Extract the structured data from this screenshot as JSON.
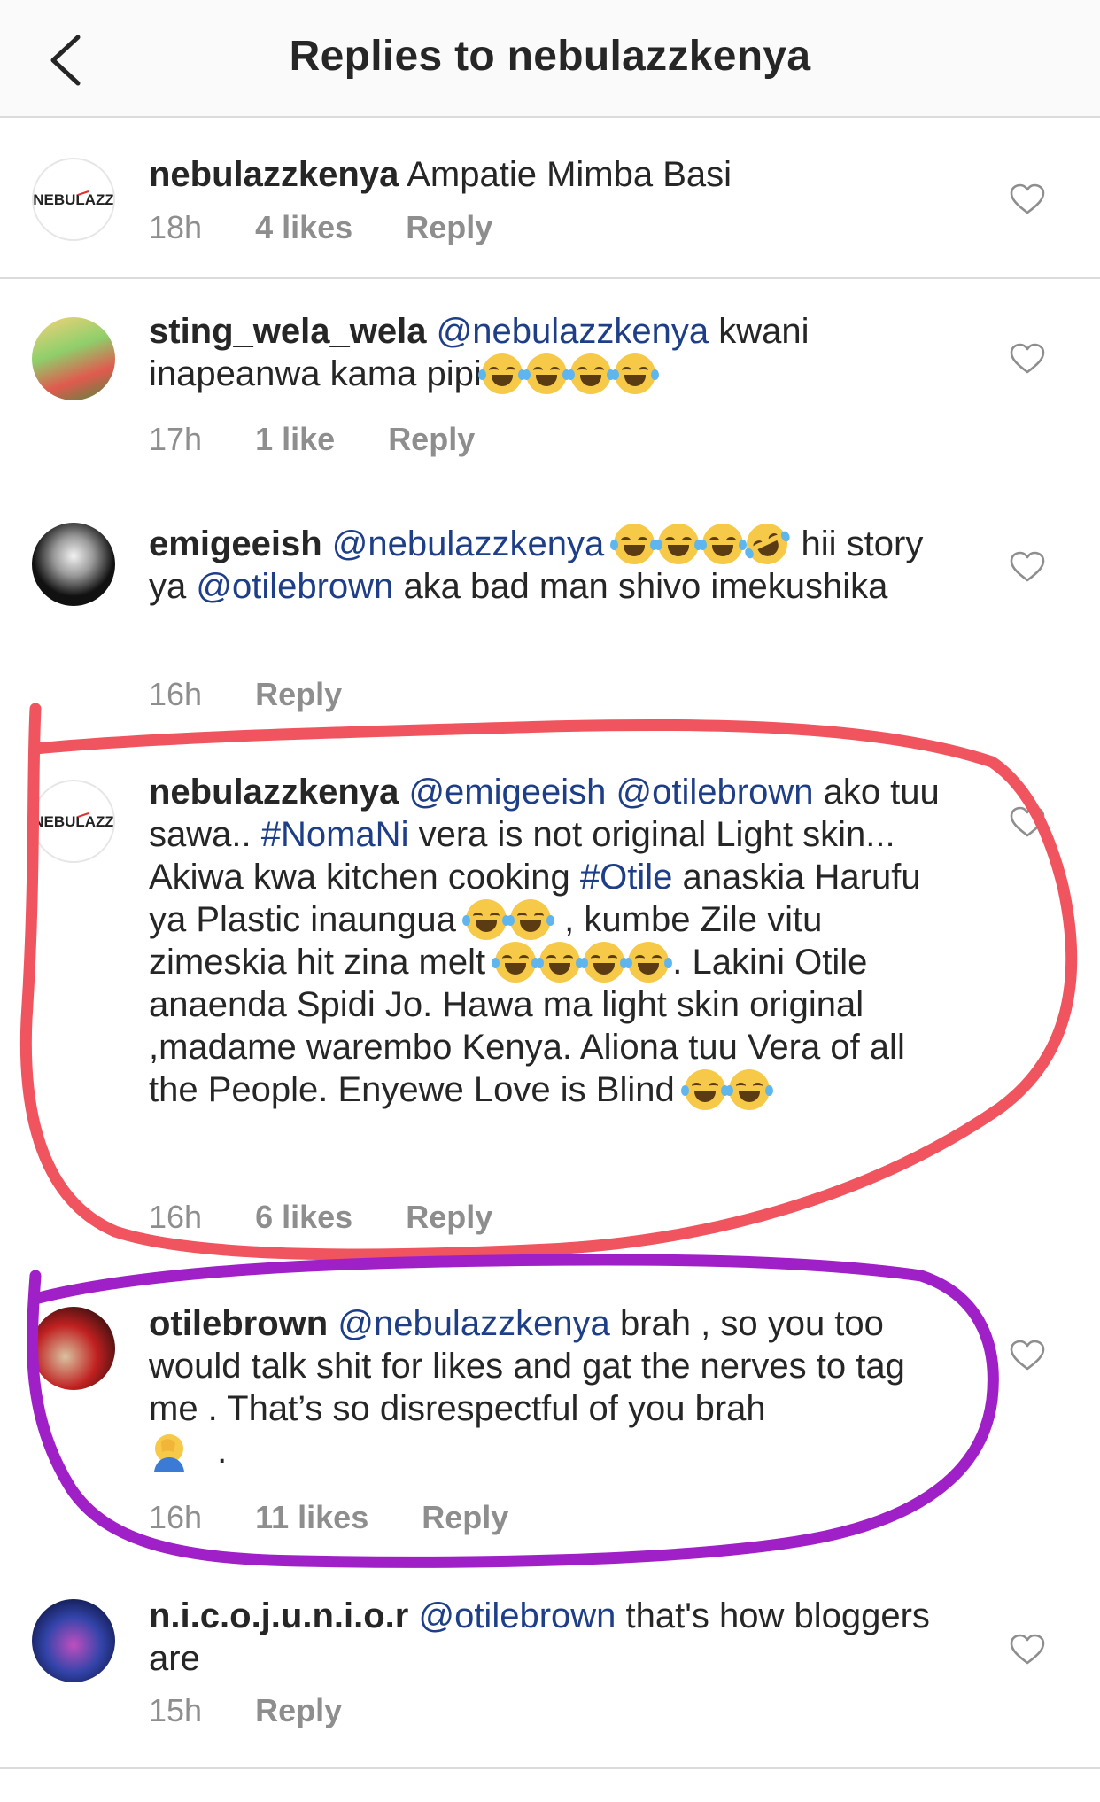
{
  "header": {
    "title": "Replies to nebulazzkenya"
  },
  "comments": [
    {
      "username": "nebulazzkenya",
      "avatar_text": "NEBULAZZ",
      "text": "Ampatie Mimba Basi",
      "time": "18h",
      "likes": "4 likes",
      "reply": "Reply"
    },
    {
      "username": "sting_wela_wela",
      "mention": "@nebulazzkenya",
      "text_a": "kwani inapeanwa kama pipi",
      "time": "17h",
      "likes": "1 like",
      "reply": "Reply"
    },
    {
      "username": "emigeeish",
      "mention": "@nebulazzkenya",
      "text_a": "hii story ya",
      "mention2": "@otilebrown",
      "text_b": "aka bad man shivo imekushika",
      "time": "16h",
      "reply": "Reply"
    },
    {
      "username": "nebulazzkenya",
      "avatar_text": "NEBULAZZ",
      "mention": "@emigeeish",
      "mention2": "@otilebrown",
      "text_a": "ako tuu sawa..",
      "hashtag1": "#NomaNi",
      "text_b": "vera is not original Light skin... Akiwa kwa kitchen cooking",
      "hashtag2": "#Otile",
      "text_c": "anaskia Harufu ya Plastic inaungua",
      "text_d": ", kumbe Zile vitu zimeskia hit zina melt",
      "text_e": ". Lakini Otile anaenda Spidi Jo. Hawa ma light skin original ,madame warembo Kenya. Aliona tuu Vera of all the People. Enyewe Love is Blind",
      "time": "16h",
      "likes": "6 likes",
      "reply": "Reply"
    },
    {
      "username": "otilebrown",
      "mention": "@nebulazzkenya",
      "text_a": "brah , so you too would talk shit for likes and gat the nerves to tag me . That’s so disrespectful of you brah",
      "text_b": ".",
      "time": "16h",
      "likes": "11 likes",
      "reply": "Reply"
    },
    {
      "username": "n.i.c.o.j.u.n.i.o.r",
      "mention": "@otilebrown",
      "text_a": "that's how bloggers are",
      "time": "15h",
      "reply": "Reply"
    }
  ],
  "colors": {
    "mention": "#1e3f88",
    "meta": "#8e8e8e",
    "red_circle": "#f0545e",
    "purple_circle": "#a020c8"
  },
  "icons": [
    "back-arrow-icon",
    "heart-icon",
    "tears-of-joy-emoji",
    "rofl-emoji",
    "facepalm-emoji"
  ]
}
